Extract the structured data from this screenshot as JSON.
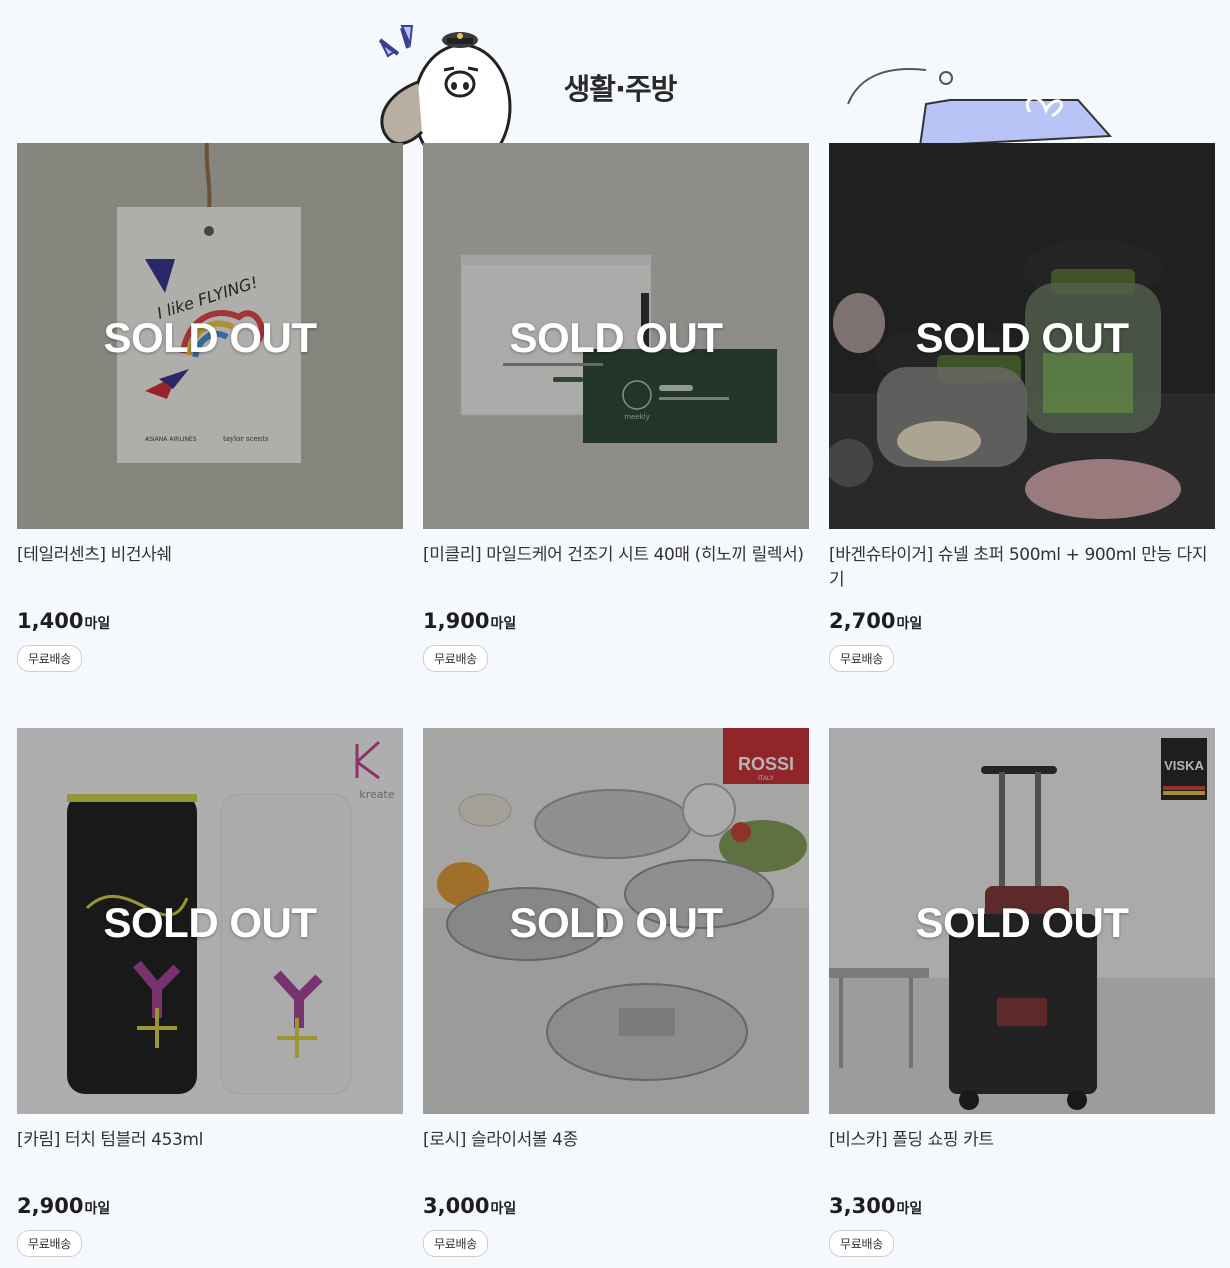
{
  "section": {
    "title": "생활·주방"
  },
  "sold_out_label": "SOLD OUT",
  "price_unit": "마일",
  "shipping_badge": "무료배송",
  "products": [
    {
      "name": "[테일러센츠] 비건사쉐",
      "price": "1,400"
    },
    {
      "name": "[미클리] 마일드케어 건조기 시트 40매 (히노끼 릴렉서)",
      "price": "1,900"
    },
    {
      "name": "[바겐슈타이거] 슈넬 초퍼 500ml + 900ml 만능 다지기",
      "price": "2,700"
    },
    {
      "name": "[카림] 터치 텀블러 453ml",
      "price": "2,900"
    },
    {
      "name": "[로시] 슬라이서볼 4종",
      "price": "3,000"
    },
    {
      "name": "[비스카] 폴딩 쇼핑 카트",
      "price": "3,300"
    }
  ],
  "image_texts": {
    "sachet_tag": "I like FLYING!",
    "sachet_brand_left": "ASIANA AIRLINES",
    "sachet_brand_right": "taylor scents",
    "dryer_brand": "meekly",
    "tumbler_brand": "kreate",
    "rossi_brand": "ROSSI",
    "rossi_country": "ITALY",
    "viska_brand": "VISKA"
  },
  "colors": {
    "background": "#f5f9fd",
    "overlay": "rgba(40,40,40,0.35)",
    "sold_out_text": "#ffffff",
    "rossi_red": "#c8262c"
  }
}
